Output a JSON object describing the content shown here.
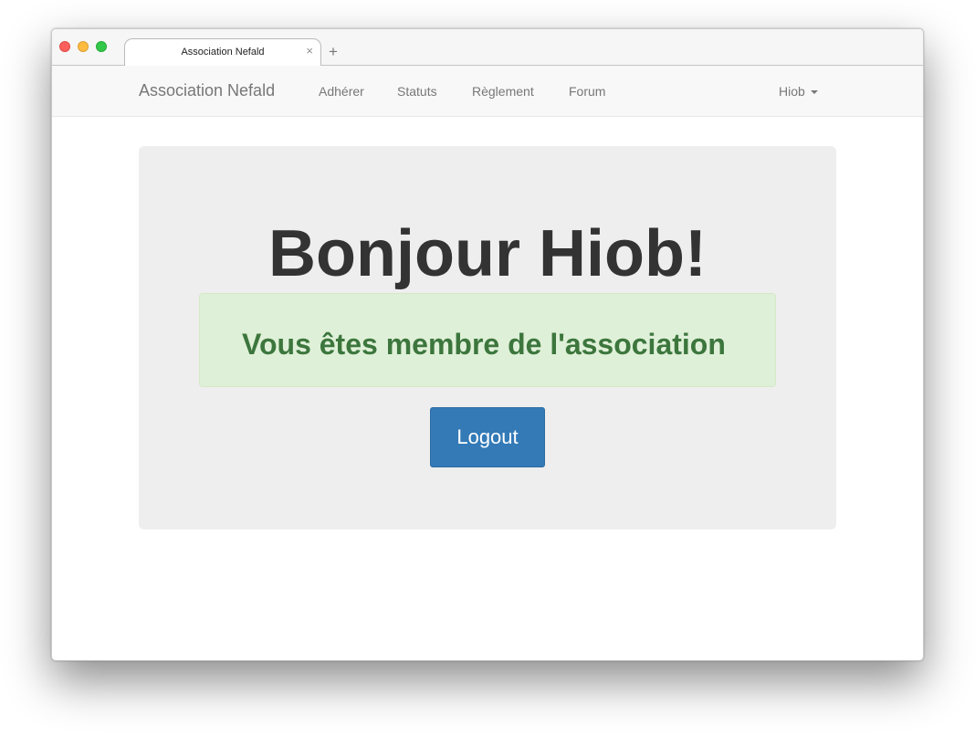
{
  "browser": {
    "tab_title": "Association Nefald",
    "tab_close_glyph": "×",
    "new_tab_glyph": "+"
  },
  "navbar": {
    "brand": "Association Nefald",
    "links": [
      "Adhérer",
      "Statuts",
      "Règlement",
      "Forum"
    ],
    "user_menu": "Hiob"
  },
  "jumbotron": {
    "greeting": "Bonjour Hiob!",
    "status_message": "Vous êtes membre de l'association",
    "logout_label": "Logout"
  },
  "colors": {
    "primary_button": "#337ab7",
    "success_bg": "#dff0d8",
    "success_text": "#3c763d",
    "jumbotron_bg": "#eeeeee",
    "navbar_bg": "#f8f8f8"
  }
}
